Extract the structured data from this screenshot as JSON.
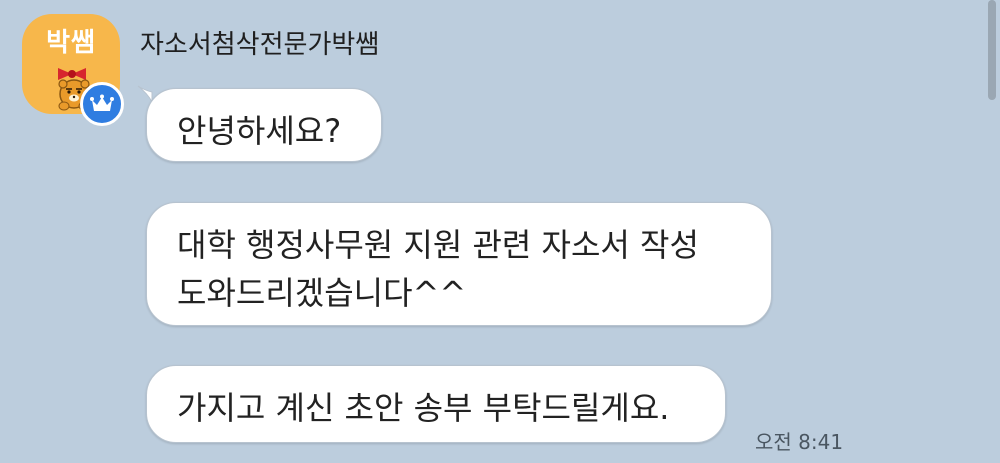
{
  "chat": {
    "avatar_label": "박쌤",
    "sender_name": "자소서첨삭전문가박쌤",
    "messages": [
      {
        "text": "안녕하세요?"
      },
      {
        "line1": "대학 행정사무원 지원 관련 자소서 작성",
        "line2": "도와드리겠습니다^^"
      },
      {
        "text": "가지고 계신 초안 송부 부탁드릴게요."
      }
    ],
    "timestamp": "오전 8:41"
  },
  "colors": {
    "chat_background": "#bccddd",
    "avatar_background": "#f7b74b",
    "badge_blue": "#2f7de1",
    "bubble_white": "#ffffff"
  },
  "icons": {
    "avatar_character": "ryan-character-icon",
    "badge": "crown-icon"
  }
}
